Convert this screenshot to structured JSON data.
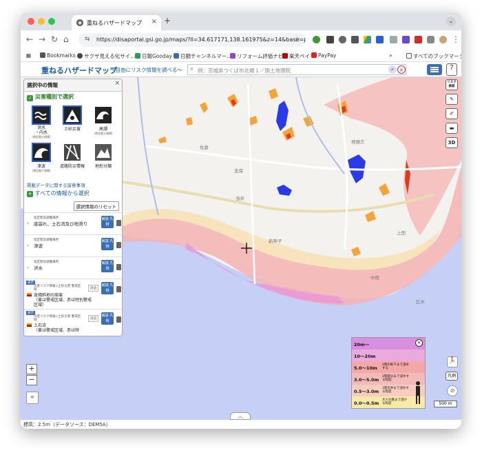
{
  "browser": {
    "tab_title": "重ねるハザードマップ",
    "url": "https://disaportal.gsi.go.jp/maps/?ll=34.617171,138.161975&z=14&base=pale&l...",
    "new_tab": "+",
    "bookmarks": [
      {
        "label": "Bookmarks",
        "color": "#555555"
      },
      {
        "label": "サクサ見える化サイ...",
        "color": "#444444"
      },
      {
        "label": "日報Gooday",
        "color": "#2a9a5a"
      },
      {
        "label": "日額チャンネルマー...",
        "color": "#3a6fb8"
      },
      {
        "label": "リフォーム評価ナビ",
        "color": "#8a4ac8"
      },
      {
        "label": "楽天ペイ",
        "color": "#c00000"
      },
      {
        "label": "PayPay",
        "color": "#e0202a"
      }
    ],
    "bookmarks_more": "»",
    "all_bookmarks": "すべてのブックマーク"
  },
  "app": {
    "title": "重ねるハザードマップ",
    "subtitle": "～自由にリスク情報を調べる～",
    "search_placeholder": "例：茨城県つくば市北郷１／国土地理院",
    "help": "?"
  },
  "panel": {
    "title": "選択中の情報",
    "close": "×",
    "disaster_heading": "災害種別で選択",
    "hazards": [
      {
        "label": "洪水\n・内水",
        "note": "(想定最大規模)",
        "selected": true
      },
      {
        "label": "土砂災害",
        "note": "",
        "selected": true
      },
      {
        "label": "高潮",
        "note": "(想定最大規模)",
        "selected": false
      },
      {
        "label": "津波",
        "note": "(想定最大規模)",
        "selected": true
      },
      {
        "label": "道路防災情報",
        "note": "",
        "selected": false
      },
      {
        "label": "地形分類",
        "note": "",
        "selected": false
      }
    ],
    "notice_link": "掲載データに関する留意事項",
    "all_info": "すべての情報から選択",
    "reset": "選択情報のリセット",
    "layers": [
      {
        "small": "指定緊急避難場所",
        "name": "崖崩れ、土石流及び地滑り",
        "legend": "解説 凡例"
      },
      {
        "small": "指定緊急避難場所",
        "name": "津波",
        "legend": "解説 凡例"
      },
      {
        "small": "指定緊急避難場所",
        "name": "洪水",
        "legend": "解説 凡例"
      },
      {
        "tag": "表示",
        "small": "災害リスク情報>土砂災害 警戒区域",
        "name": "急傾斜地の崩壊\n（黄は警戒区域、赤は特別警戒区域）",
        "legend": "解説 凡例",
        "opacity": "透過"
      },
      {
        "tag": "表示",
        "small": "災害リスク情報>土砂災害 警戒区域",
        "name": "土石流\n（黄は警戒区域、赤は特",
        "legend": "解説 凡例",
        "opacity": "透過"
      }
    ]
  },
  "map": {
    "place_labels": [
      "佐倉",
      "支保",
      "浅井",
      "新神子",
      "中原",
      "地頭方",
      "上田",
      "比木"
    ],
    "tools": [
      "リスク検索",
      "✎",
      "✐",
      "▬",
      "3D"
    ],
    "zoom_in": "+",
    "zoom_out": "−",
    "expand": "︿",
    "legend_hanrei": "凡例",
    "scale": "500 m"
  },
  "legend": {
    "rows": [
      {
        "label": "20m～",
        "desc": "",
        "color": "#d98ee0"
      },
      {
        "label": "10～20m",
        "desc": "",
        "color": "#eaaade"
      },
      {
        "label": "5.0～10m",
        "desc": "2階の軒下まで浸水する",
        "color": "#f3a7a7"
      },
      {
        "label": "3.0～5.0m",
        "desc": "2階部分まで浸水する程度",
        "color": "#f6b9b9"
      },
      {
        "label": "0.5～3.0m",
        "desc": "1階天井まで浸水する程度",
        "color": "#f8cdc0"
      },
      {
        "label": "0.0～0.5m",
        "desc": "大人の膝まで浸かる程度",
        "color": "#f8e9a8"
      }
    ],
    "close": "×"
  },
  "status": "標高：2.5m（データソース：DEM5A）"
}
